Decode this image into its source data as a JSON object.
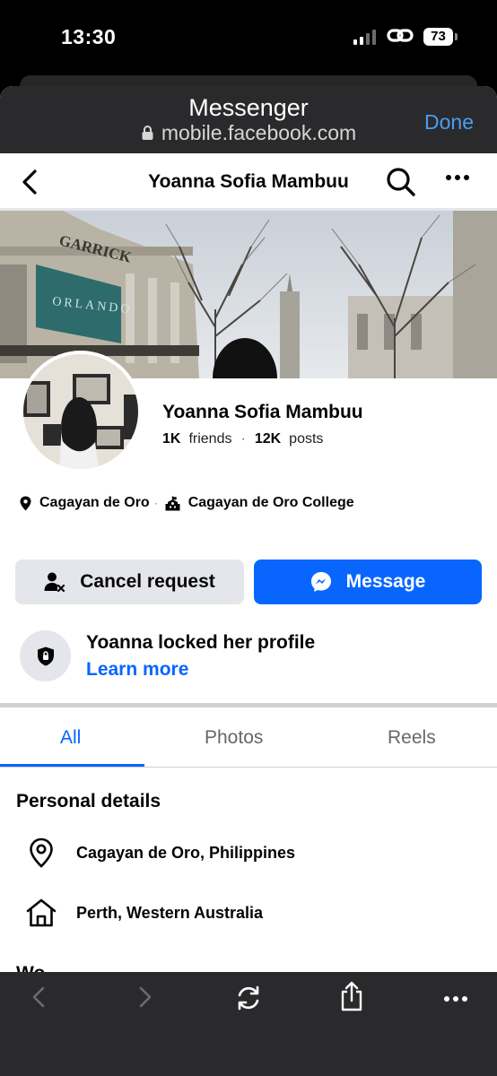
{
  "status_bar": {
    "time": "13:30",
    "battery": "73"
  },
  "browser": {
    "title": "Messenger",
    "url": "mobile.facebook.com",
    "done_label": "Done"
  },
  "nav": {
    "title": "Yoanna Sofia Mambuu"
  },
  "profile": {
    "name": "Yoanna Sofia Mambuu",
    "friends_count": "1K",
    "friends_label": "friends",
    "separator": "·",
    "posts_count": "12K",
    "posts_label": "posts",
    "location": "Cagayan de Oro",
    "meta_separator": "·",
    "school": "Cagayan de Oro College"
  },
  "actions": {
    "cancel_label": "Cancel request",
    "message_label": "Message"
  },
  "locked": {
    "title": "Yoanna locked her profile",
    "link": "Learn more"
  },
  "tabs": [
    {
      "label": "All",
      "active": true
    },
    {
      "label": "Photos",
      "active": false
    },
    {
      "label": "Reels",
      "active": false
    }
  ],
  "personal_details": {
    "title": "Personal details",
    "items": [
      {
        "icon": "location-pin-icon",
        "text": "Cagayan de Oro, Philippines"
      },
      {
        "icon": "home-icon",
        "text": "Perth, Western Australia"
      }
    ],
    "next_heading_partial": "Wo"
  },
  "cover": {
    "sign_text": "GARRICK",
    "banner_text": "ORLANDO"
  },
  "colors": {
    "accent": "#0866ff",
    "secondary_button": "#e4e6eb",
    "browser_chrome": "#2a2a2c",
    "done_link": "#4a9df0"
  }
}
